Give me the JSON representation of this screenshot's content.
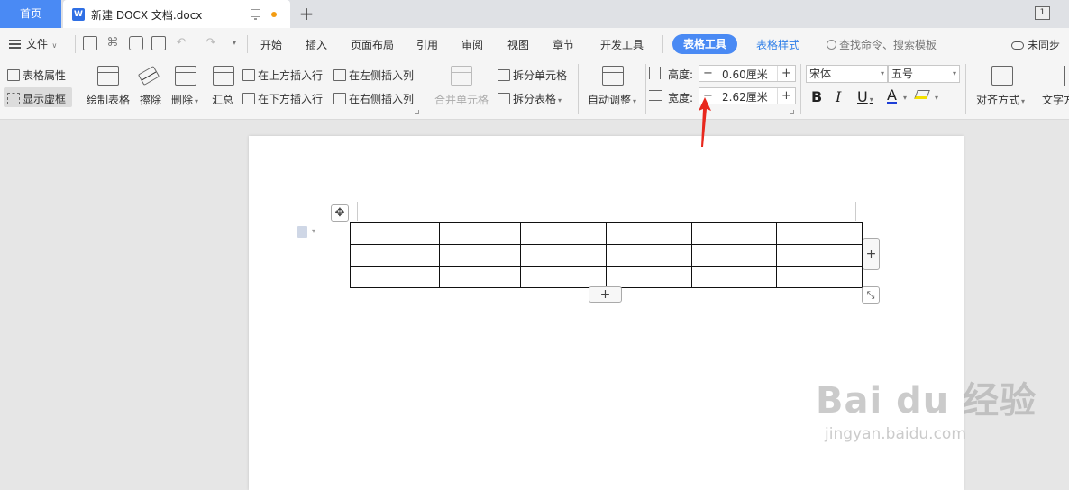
{
  "titlebar": {
    "home_tab": "首页",
    "doc_tab_title": "新建 DOCX 文档.docx",
    "doc_icon_letter": "W",
    "new_tab": "+",
    "window_button": "1"
  },
  "menubar": {
    "file_label": "文件",
    "tabs": [
      "开始",
      "插入",
      "页面布局",
      "引用",
      "审阅",
      "视图",
      "章节",
      "开发工具"
    ],
    "active_tab": "表格工具",
    "extra_tab": "表格样式",
    "search_placeholder": "查找命令、搜索模板",
    "sync_label": "未同步"
  },
  "ribbon": {
    "table_properties": "表格属性",
    "show_gridlines": "显示虚框",
    "draw_table": "绘制表格",
    "erase": "擦除",
    "delete": "删除",
    "summary": "汇总",
    "insert_row_above": "在上方插入行",
    "insert_row_below": "在下方插入行",
    "insert_col_left": "在左侧插入列",
    "insert_col_right": "在右侧插入列",
    "merge_cells": "合并单元格",
    "split_cells": "拆分单元格",
    "split_table": "拆分表格",
    "auto_adjust": "自动调整",
    "height_label": "高度:",
    "height_value": "0.60厘米",
    "width_label": "宽度:",
    "width_value": "2.62厘米",
    "font_name": "宋体",
    "font_size": "五号",
    "bold": "B",
    "italic": "I",
    "underline": "U",
    "font_color": "A",
    "align": "对齐方式",
    "text_direction": "文字方"
  },
  "document": {
    "table": {
      "rows": 3,
      "columns": 6
    },
    "add_row": "+",
    "add_col": "+"
  },
  "watermark": {
    "brand": "Bai du 经验",
    "url": "jingyan.baidu.com"
  },
  "colors": {
    "accent": "#4a8af4",
    "arrow": "#e8281e",
    "font_color_bar": "#1d3ed6",
    "highlight_bar": "#f4e000"
  }
}
